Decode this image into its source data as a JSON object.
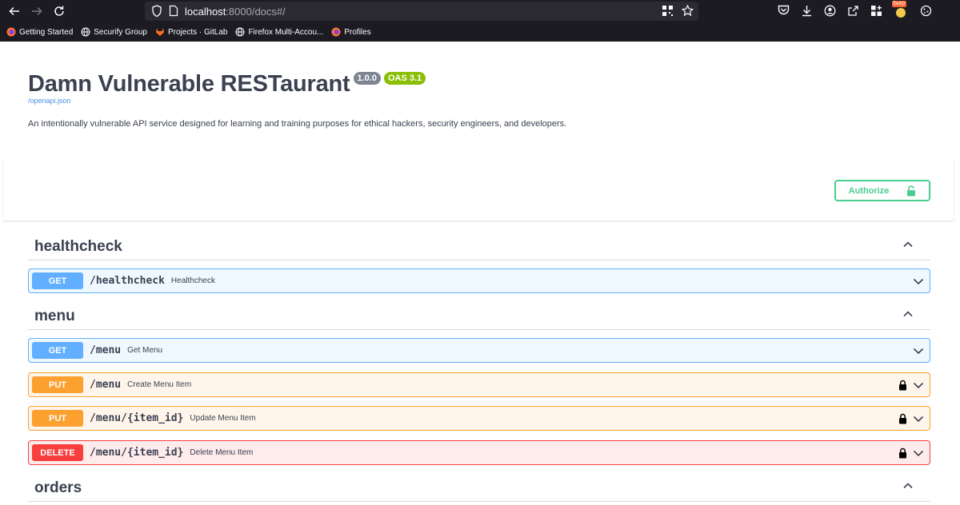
{
  "browser": {
    "url_host": "localhost",
    "url_rest": ":8000/docs#/",
    "bookmarks": [
      {
        "label": "Getting Started",
        "icon": "firefox-icon"
      },
      {
        "label": "Securify Group",
        "icon": "globe-icon"
      },
      {
        "label": "Projects · GitLab",
        "icon": "gitlab-icon"
      },
      {
        "label": "Firefox Multi-Accou...",
        "icon": "globe-icon"
      },
      {
        "label": "Profiles",
        "icon": "firefox-icon"
      }
    ],
    "extension_badge": "burp"
  },
  "info": {
    "title": "Damn Vulnerable RESTaurant",
    "version": "1.0.0",
    "oas": "OAS 3.1",
    "spec_link": "/openapi.json",
    "description": "An intentionally vulnerable API service designed for learning and training purposes for ethical hackers, security engineers, and developers."
  },
  "authorize_label": "Authorize",
  "tags": [
    {
      "name": "healthcheck"
    },
    {
      "name": "menu"
    },
    {
      "name": "orders"
    }
  ],
  "operations": [
    {
      "method": "GET",
      "path": "/healthcheck",
      "summary": "Healthcheck",
      "locked": false
    },
    {
      "method": "GET",
      "path": "/menu",
      "summary": "Get Menu",
      "locked": false
    },
    {
      "method": "PUT",
      "path": "/menu",
      "summary": "Create Menu Item",
      "locked": true
    },
    {
      "method": "PUT",
      "path": "/menu/{item_id}",
      "summary": "Update Menu Item",
      "locked": true
    },
    {
      "method": "DELETE",
      "path": "/menu/{item_id}",
      "summary": "Delete Menu Item",
      "locked": true
    }
  ],
  "colors": {
    "get": "#61affe",
    "put": "#fca130",
    "delete": "#f93e3e",
    "authorize": "#49cc90",
    "oas_badge": "#89bf04",
    "version_badge": "#7d8492"
  }
}
